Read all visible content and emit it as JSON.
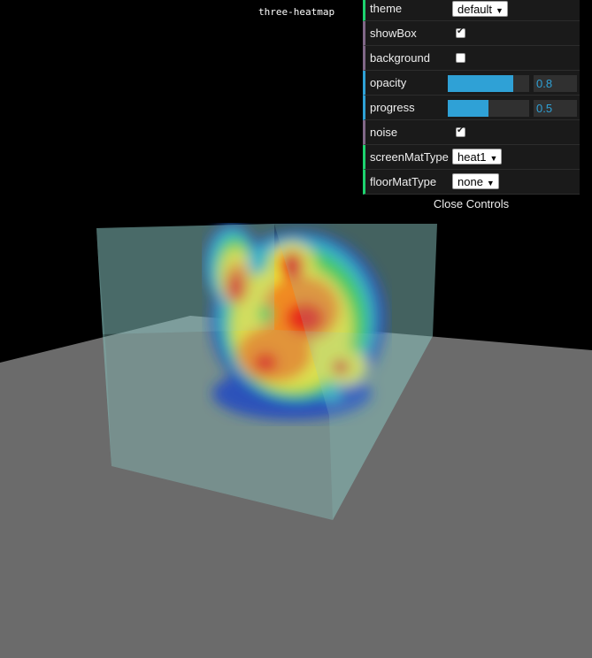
{
  "page_title": "three-heatmap",
  "controls": [
    {
      "key": "theme",
      "label": "theme",
      "type": "select",
      "value": "default"
    },
    {
      "key": "showBox",
      "label": "showBox",
      "type": "checkbox",
      "checked": true
    },
    {
      "key": "background",
      "label": "background",
      "type": "checkbox",
      "checked": false
    },
    {
      "key": "opacity",
      "label": "opacity",
      "type": "slider",
      "value": "0.8",
      "fraction": 0.8
    },
    {
      "key": "progress",
      "label": "progress",
      "type": "slider",
      "value": "0.5",
      "fraction": 0.5
    },
    {
      "key": "noise",
      "label": "noise",
      "type": "checkbox",
      "checked": true
    },
    {
      "key": "screenMatType",
      "label": "screenMatType",
      "type": "select",
      "value": "heat1"
    },
    {
      "key": "floorMatType",
      "label": "floorMatType",
      "type": "select",
      "value": "none"
    }
  ],
  "close_label": "Close Controls",
  "colors": {
    "background": "#000000",
    "floor": "#6b6b6b",
    "box": "#8ecfca",
    "slider_fill": "#2fa1d6",
    "panel": "#1a1a1a"
  }
}
